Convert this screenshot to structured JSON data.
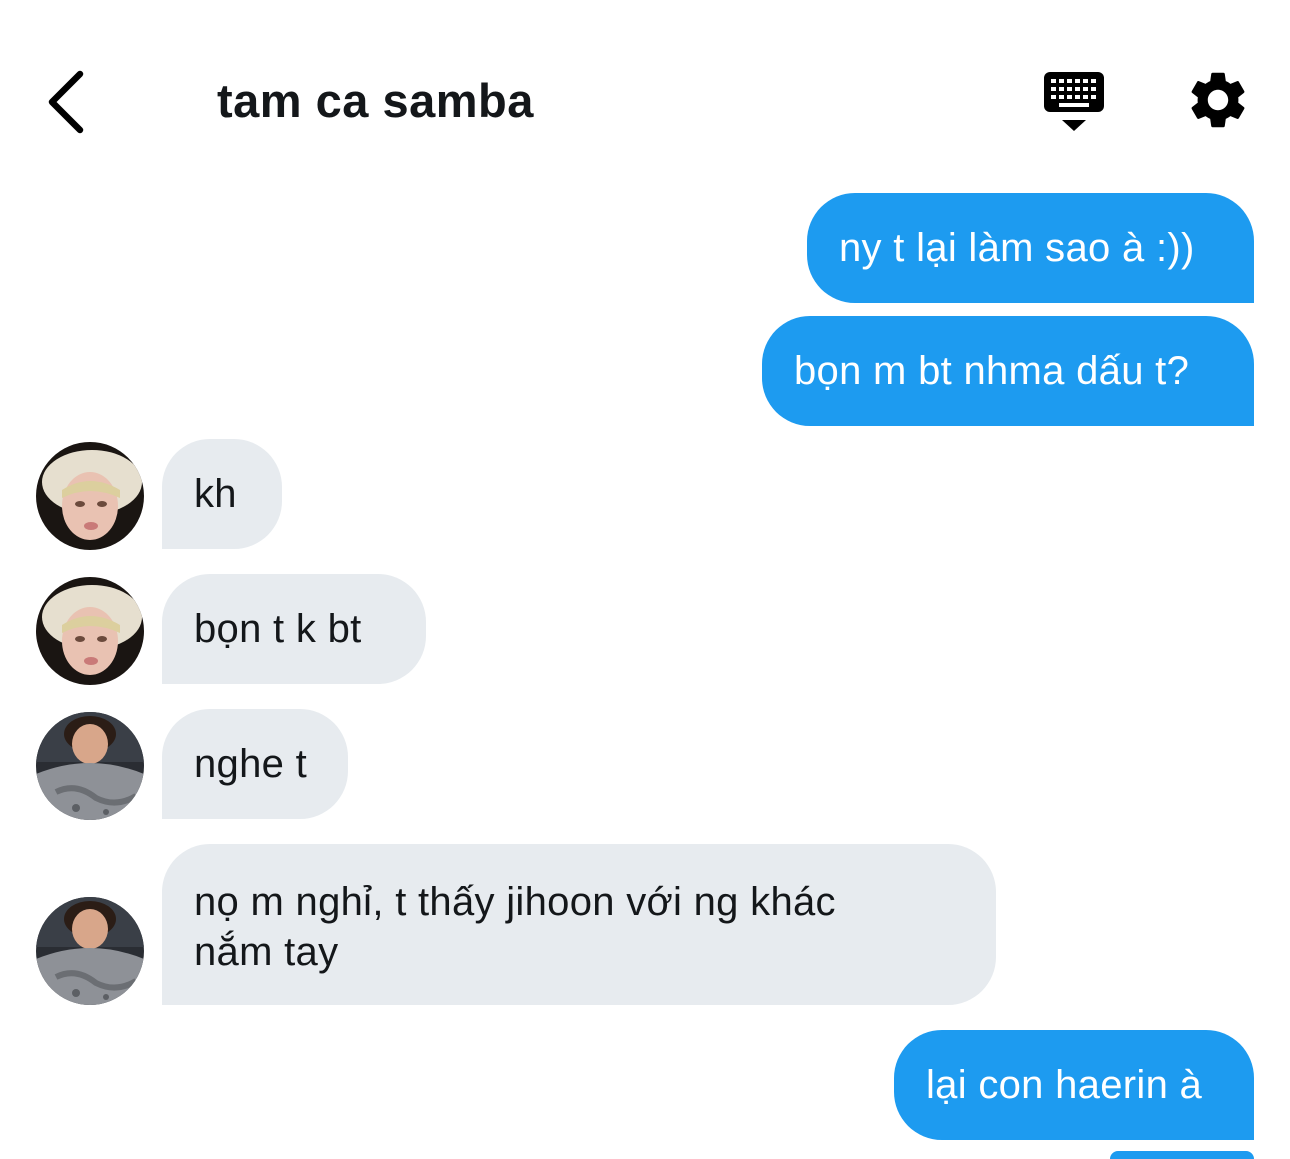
{
  "header": {
    "title": "tam ca samba",
    "back_icon": "chevron-left-icon",
    "keyboard_icon": "keyboard-icon",
    "settings_icon": "gear-icon"
  },
  "colors": {
    "outgoing_bubble": "#1d9bf0",
    "incoming_bubble": "#e7ebef",
    "text_dark": "#14171a"
  },
  "messages": [
    {
      "direction": "out",
      "text": "ny t lại làm sao à :))"
    },
    {
      "direction": "out",
      "text": "bọn m bt nhma dấu t?"
    },
    {
      "direction": "in",
      "sender_avatar": "avatar-blonde-cap",
      "text": "kh"
    },
    {
      "direction": "in",
      "sender_avatar": "avatar-blonde-cap",
      "text": "bọn t k bt"
    },
    {
      "direction": "in",
      "sender_avatar": "avatar-dark-hair",
      "text": "nghe t"
    },
    {
      "direction": "in",
      "sender_avatar": "avatar-dark-hair",
      "text": "nọ m nghỉ, t thấy jihoon với ng khác nắm tay"
    },
    {
      "direction": "out",
      "text": "lại con haerin à"
    }
  ]
}
